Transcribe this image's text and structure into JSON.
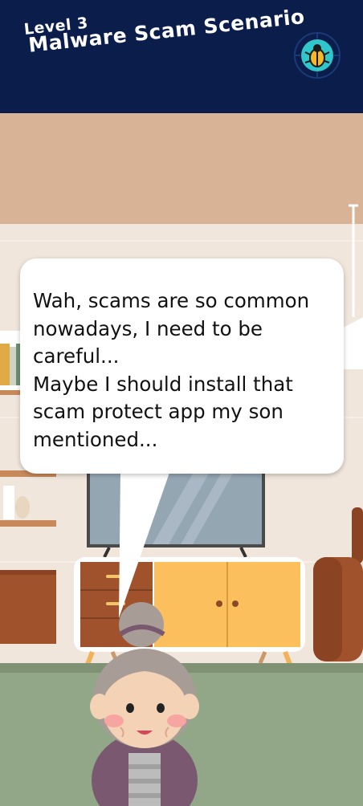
{
  "header": {
    "level_label": "Level 3",
    "title": "Malware Scam Scenario",
    "badge_icon": "bug-shield-icon"
  },
  "dialogue": {
    "text": "Wah, scams are so common nowadays, I need to be careful...\nMaybe I should install that scam protect app my son mentioned..."
  },
  "scene": {
    "character": "grandmother",
    "colors": {
      "header_bg": "#0b1d4a",
      "floor": "#92a787",
      "wall": "#f0e6dc",
      "upper_wall": "#d8b396",
      "cabinet_orange": "#fbbf5e",
      "wood": "#a0522d",
      "badge_teal": "#2fc6cc"
    }
  }
}
